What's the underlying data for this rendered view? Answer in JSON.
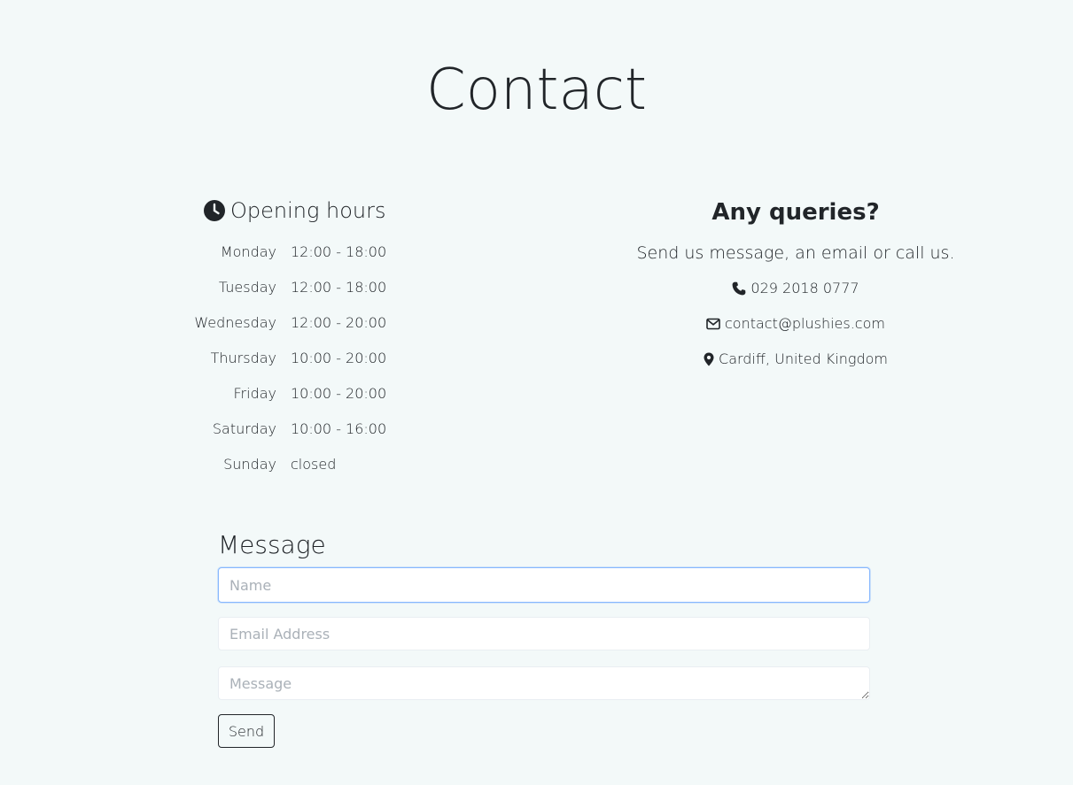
{
  "page": {
    "title": "Contact"
  },
  "hours": {
    "heading": "Opening hours",
    "icon": "clock-icon",
    "rows": [
      {
        "day": "Monday",
        "time": "12:00 - 18:00"
      },
      {
        "day": "Tuesday",
        "time": "12:00 - 18:00"
      },
      {
        "day": "Wednesday",
        "time": "12:00 - 20:00"
      },
      {
        "day": "Thursday",
        "time": "10:00 - 20:00"
      },
      {
        "day": "Friday",
        "time": "10:00 - 20:00"
      },
      {
        "day": "Saturday",
        "time": "10:00 - 16:00"
      },
      {
        "day": "Sunday",
        "time": "closed"
      }
    ]
  },
  "queries": {
    "title": "Any queries?",
    "text": "Send us message, an email or call us.",
    "phone": {
      "icon": "phone-icon",
      "text": "029 2018 0777"
    },
    "email": {
      "icon": "envelope-icon",
      "text": "contact@plushies.com"
    },
    "location": {
      "icon": "map-marker-icon",
      "text": "Cardiff, United Kingdom"
    }
  },
  "form": {
    "title": "Message",
    "name_placeholder": "Name",
    "email_placeholder": "Email Address",
    "message_placeholder": "Message",
    "send_label": "Send"
  }
}
